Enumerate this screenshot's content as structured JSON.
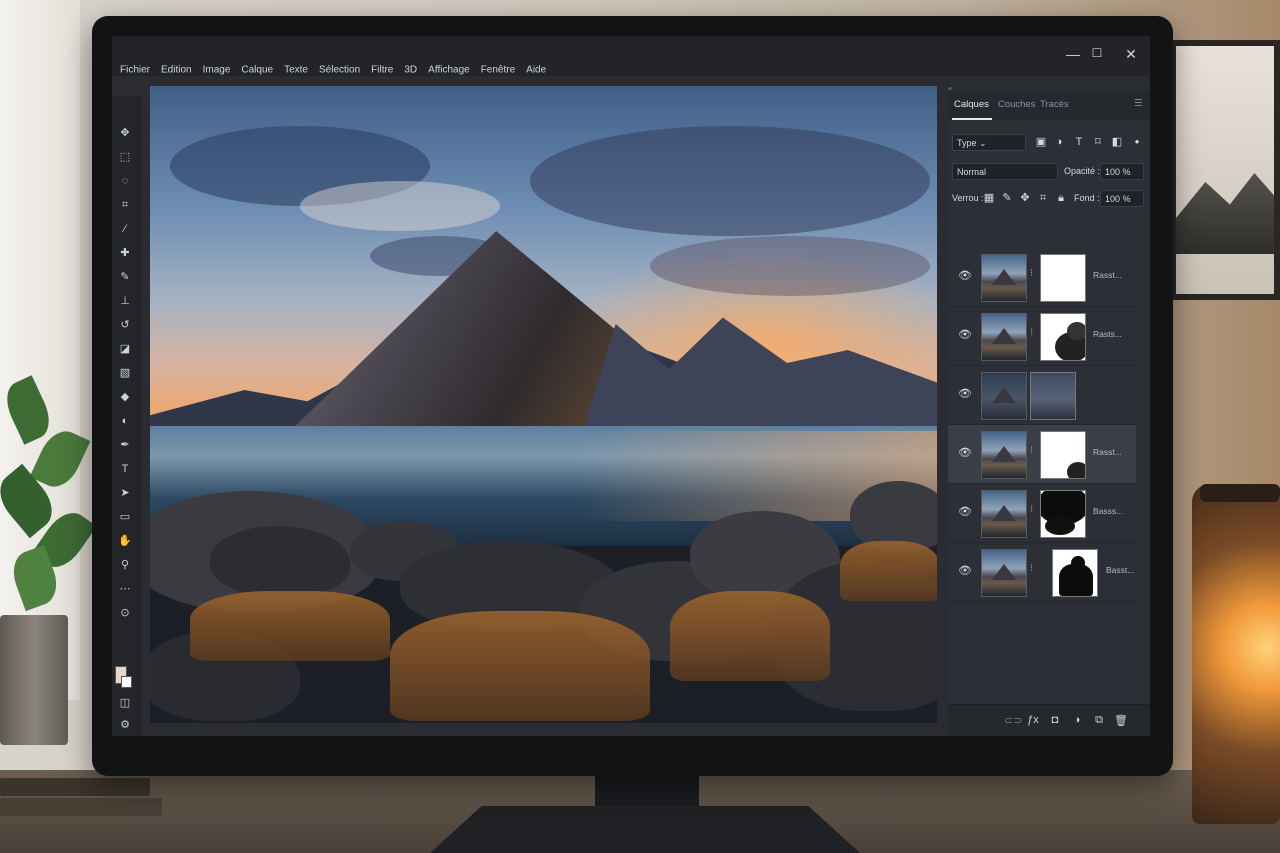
{
  "menu": [
    "Fichier",
    "Edition",
    "Image",
    "Calque",
    "Texte",
    "Sélection",
    "Filtre",
    "3D",
    "Affichage",
    "Fenêtre",
    "Aide"
  ],
  "window_controls": {
    "minimize": "—",
    "maximize": "☐",
    "close": "✕"
  },
  "layers_panel": {
    "tabs": [
      "Calques",
      "Couches",
      "Tracés"
    ],
    "active_tab": "Calques",
    "filter_type": "Type",
    "blend_mode": "Normal",
    "opacity_label": "Opacité :",
    "opacity_value": "100 %",
    "lock_label": "Verrou :",
    "fill_label": "Fond :",
    "fill_value": "100 %",
    "layers": [
      {
        "name": "Rasst...",
        "mask": "full-white",
        "selected": false
      },
      {
        "name": "Rasts...",
        "mask": "dark-cloud",
        "selected": false
      },
      {
        "name": "",
        "mask": "image",
        "selected": false
      },
      {
        "name": "Rasst...",
        "mask": "white-corner",
        "selected": true
      },
      {
        "name": "Basss...",
        "mask": "dark-top",
        "selected": false
      },
      {
        "name": "Basst...",
        "mask": "dark-figure",
        "selected": false
      }
    ]
  },
  "colors": {
    "panel_bg": "#2c2f35",
    "menubar_bg": "#222428",
    "selected_layer": "#3a3e46"
  }
}
